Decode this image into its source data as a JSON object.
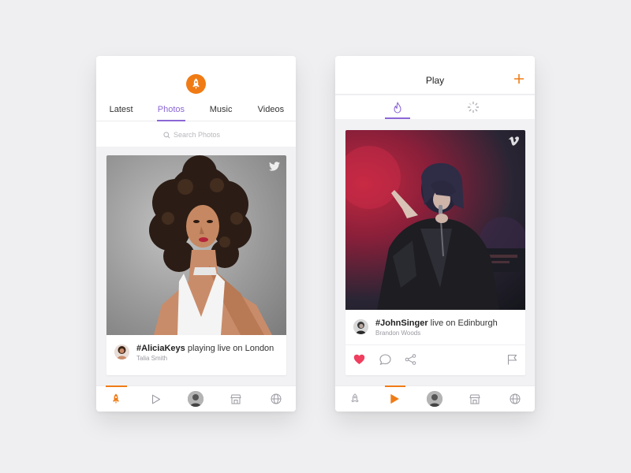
{
  "left_screen": {
    "tabs": [
      {
        "label": "Latest",
        "active": false
      },
      {
        "label": "Photos",
        "active": true
      },
      {
        "label": "Music",
        "active": false
      },
      {
        "label": "Videos",
        "active": false
      }
    ],
    "search": {
      "placeholder": "Search Photos"
    },
    "card": {
      "source_icon": "twitter-icon",
      "hashtag": "#AliciaKeys",
      "title_rest": " playing live on London",
      "author": "Talia Smith"
    },
    "active_nav": "home"
  },
  "right_screen": {
    "title": "Play",
    "subtabs": [
      {
        "icon": "flame-icon",
        "active": true
      },
      {
        "icon": "loading-icon",
        "active": false
      }
    ],
    "card": {
      "source_icon": "vimeo-icon",
      "hashtag": "#JohnSinger",
      "title_rest": " live on Edinburgh",
      "author": "Brandon Woods",
      "liked": true
    },
    "active_nav": "play"
  },
  "colors": {
    "accent_orange": "#f07b14",
    "accent_purple": "#8b67d6",
    "like_red": "#f03e5e",
    "icon_gray": "#9a9aa2"
  }
}
